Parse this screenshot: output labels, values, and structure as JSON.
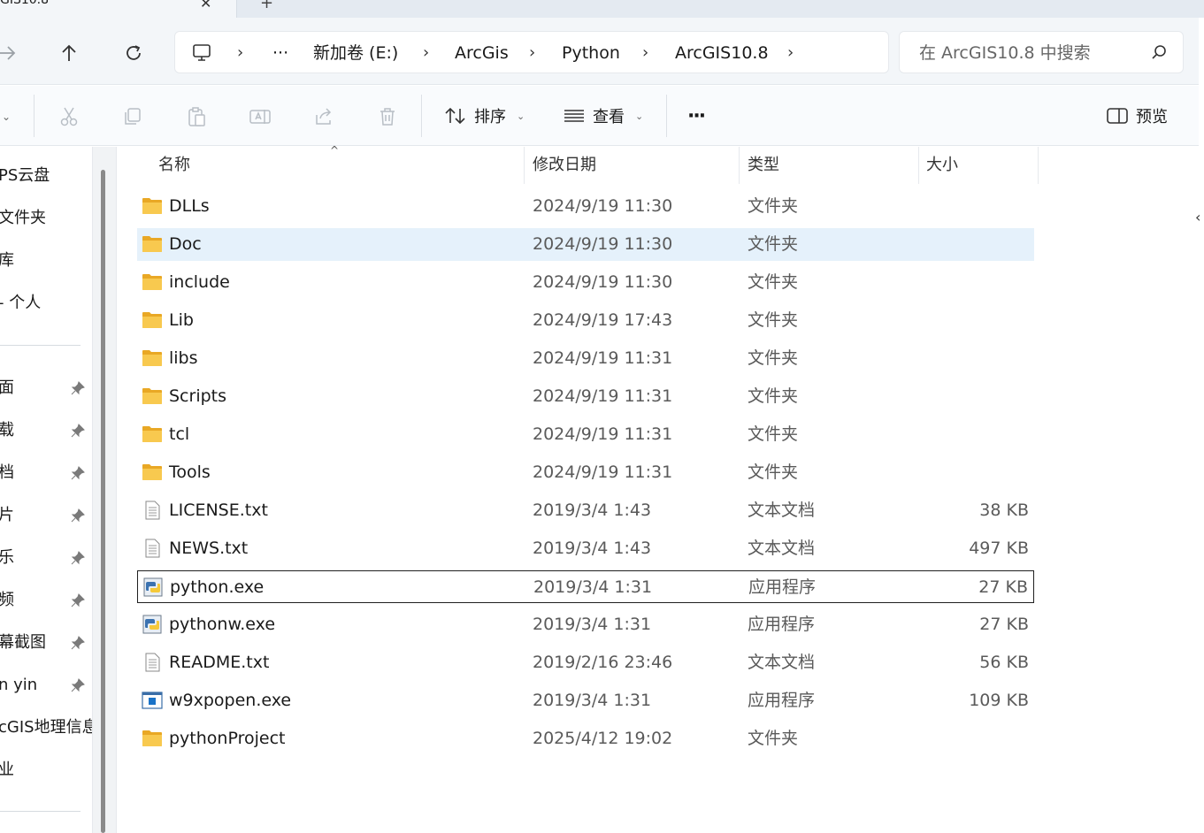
{
  "tab": {
    "title": "GIS10.8",
    "close_glyph": "✕",
    "new_glyph": "+"
  },
  "address": {
    "more": "···",
    "crumbs": [
      "新加卷 (E:)",
      "ArcGis",
      "Python",
      "ArcGIS10.8"
    ],
    "chevron": "›"
  },
  "search": {
    "placeholder": "在 ArcGIS10.8 中搜索"
  },
  "toolbar": {
    "sort_label": "排序",
    "view_label": "查看",
    "more_label": "···",
    "preview_label": "预览"
  },
  "sidebar": {
    "items": [
      {
        "label": "PS云盘",
        "pinned": false
      },
      {
        "label": "文件夹",
        "pinned": false
      },
      {
        "label": "库",
        "pinned": false
      },
      {
        "label": "- 个人",
        "pinned": false
      },
      {
        "label": "面",
        "pinned": true
      },
      {
        "label": "载",
        "pinned": true
      },
      {
        "label": "档",
        "pinned": true
      },
      {
        "label": "片",
        "pinned": true
      },
      {
        "label": "乐",
        "pinned": true
      },
      {
        "label": "频",
        "pinned": true
      },
      {
        "label": "幕截图",
        "pinned": true
      },
      {
        "label": "n yin",
        "pinned": true
      },
      {
        "label": "cGIS地理信息",
        "pinned": false
      },
      {
        "label": "业",
        "pinned": false
      }
    ]
  },
  "columns": {
    "name": "名称",
    "date": "修改日期",
    "type": "类型",
    "size": "大小"
  },
  "files": [
    {
      "name": "DLLs",
      "date": "2024/9/19 11:30",
      "type": "文件夹",
      "size": "",
      "icon": "folder-icon"
    },
    {
      "name": "Doc",
      "date": "2024/9/19 11:30",
      "type": "文件夹",
      "size": "",
      "icon": "folder-icon"
    },
    {
      "name": "include",
      "date": "2024/9/19 11:30",
      "type": "文件夹",
      "size": "",
      "icon": "folder-icon"
    },
    {
      "name": "Lib",
      "date": "2024/9/19 17:43",
      "type": "文件夹",
      "size": "",
      "icon": "folder-icon"
    },
    {
      "name": "libs",
      "date": "2024/9/19 11:31",
      "type": "文件夹",
      "size": "",
      "icon": "folder-icon"
    },
    {
      "name": "Scripts",
      "date": "2024/9/19 11:31",
      "type": "文件夹",
      "size": "",
      "icon": "folder-icon"
    },
    {
      "name": "tcl",
      "date": "2024/9/19 11:31",
      "type": "文件夹",
      "size": "",
      "icon": "folder-icon"
    },
    {
      "name": "Tools",
      "date": "2024/9/19 11:31",
      "type": "文件夹",
      "size": "",
      "icon": "folder-icon"
    },
    {
      "name": "LICENSE.txt",
      "date": "2019/3/4 1:43",
      "type": "文本文档",
      "size": "38 KB",
      "icon": "text-file-icon"
    },
    {
      "name": "NEWS.txt",
      "date": "2019/3/4 1:43",
      "type": "文本文档",
      "size": "497 KB",
      "icon": "text-file-icon"
    },
    {
      "name": "python.exe",
      "date": "2019/3/4 1:31",
      "type": "应用程序",
      "size": "27 KB",
      "icon": "python-exe-icon"
    },
    {
      "name": "pythonw.exe",
      "date": "2019/3/4 1:31",
      "type": "应用程序",
      "size": "27 KB",
      "icon": "python-exe-icon"
    },
    {
      "name": "README.txt",
      "date": "2019/2/16 23:46",
      "type": "文本文档",
      "size": "56 KB",
      "icon": "text-file-icon"
    },
    {
      "name": "w9xpopen.exe",
      "date": "2019/3/4 1:31",
      "type": "应用程序",
      "size": "109 KB",
      "icon": "app-window-icon"
    },
    {
      "name": "pythonProject",
      "date": "2025/4/12 19:02",
      "type": "文件夹",
      "size": "",
      "icon": "folder-icon"
    }
  ],
  "selected_row": "Doc",
  "focused_row": "python.exe",
  "colors": {
    "selection": "#e5f1fb",
    "folder": "#f4c04e",
    "accent": "#1a73c8"
  }
}
